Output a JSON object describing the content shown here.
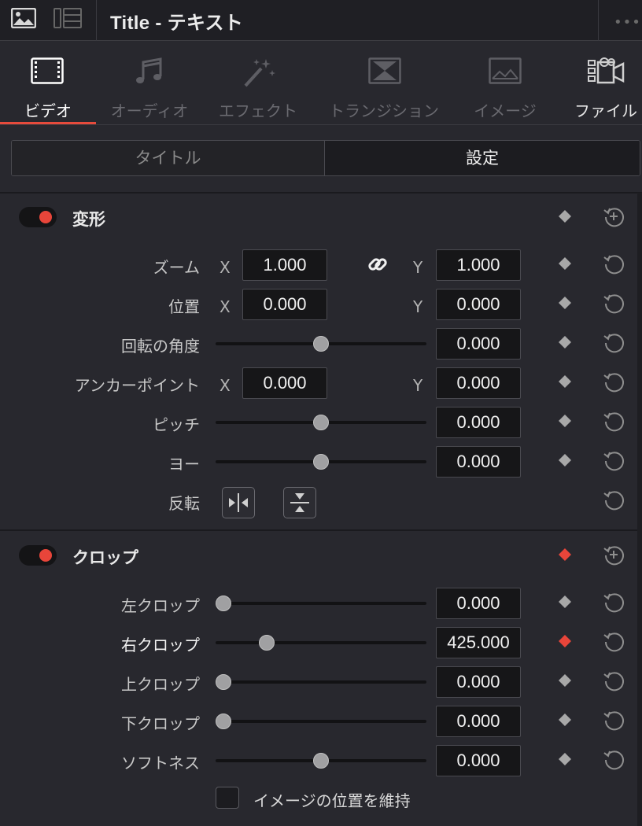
{
  "header": {
    "title": "Title - テキスト",
    "menu_icon": "more-dots-icon"
  },
  "tabs": [
    {
      "label": "ビデオ",
      "icon": "film-icon",
      "active": true
    },
    {
      "label": "オーディオ",
      "icon": "music-note-icon"
    },
    {
      "label": "エフェクト",
      "icon": "magic-wand-icon"
    },
    {
      "label": "トランジション",
      "icon": "transition-icon"
    },
    {
      "label": "イメージ",
      "icon": "image-icon"
    },
    {
      "label": "ファイル",
      "icon": "file-icon"
    }
  ],
  "segmented": {
    "left": "タイトル",
    "right": "設定",
    "selected": "設定"
  },
  "transform": {
    "title": "変形",
    "rows": {
      "zoom": {
        "label": "ズーム",
        "x_axis": "X",
        "x": "1.000",
        "y_axis": "Y",
        "y": "1.000"
      },
      "position": {
        "label": "位置",
        "x_axis": "X",
        "x": "0.000",
        "y_axis": "Y",
        "y": "0.000"
      },
      "rotation": {
        "label": "回転の角度",
        "value": "0.000",
        "slider": 0.5
      },
      "anchor": {
        "label": "アンカーポイント",
        "x_axis": "X",
        "x": "0.000",
        "y_axis": "Y",
        "y": "0.000"
      },
      "pitch": {
        "label": "ピッチ",
        "value": "0.000",
        "slider": 0.5
      },
      "yaw": {
        "label": "ヨー",
        "value": "0.000",
        "slider": 0.5
      },
      "flip": {
        "label": "反転"
      }
    }
  },
  "crop": {
    "title": "クロップ",
    "rows": {
      "left": {
        "label": "左クロップ",
        "value": "0.000",
        "slider": 0.0
      },
      "right": {
        "label": "右クロップ",
        "value": "425.000",
        "slider": 0.22
      },
      "top": {
        "label": "上クロップ",
        "value": "0.000",
        "slider": 0.0
      },
      "bottom": {
        "label": "下クロップ",
        "value": "0.000",
        "slider": 0.0
      },
      "softness": {
        "label": "ソフトネス",
        "value": "0.000",
        "slider": 0.5
      }
    },
    "retain_label": "イメージの位置を維持"
  },
  "colors": {
    "accent": "#e64b3c",
    "keyframe_active": "#e8453a",
    "keyframe": "#a8a8a8"
  }
}
